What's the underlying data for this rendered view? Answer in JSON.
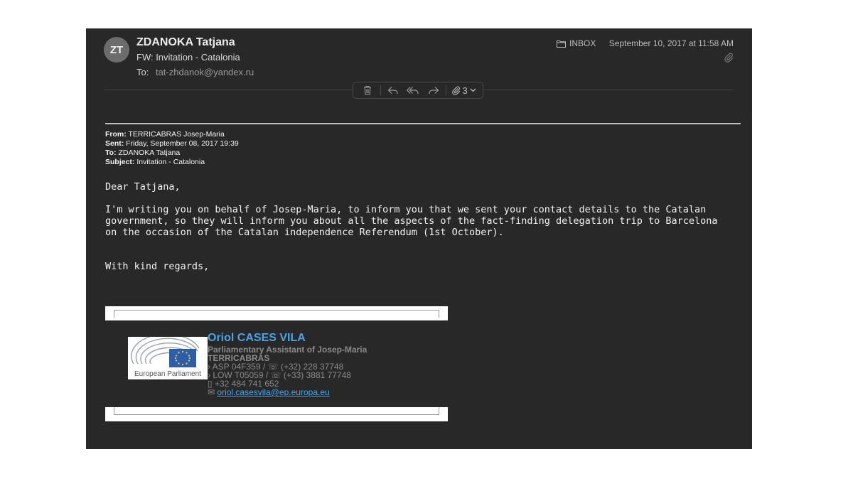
{
  "header": {
    "avatar_initials": "ZT",
    "sender": "ZDANOKA Tatjana",
    "subject": "FW: Invitation - Catalonia",
    "to_label": "To:",
    "to_address": "tat-zhdanok@yandex.ru",
    "mailbox": "INBOX",
    "date": "September 10, 2017 at 11:58 AM"
  },
  "toolbar": {
    "attachments_count": "3"
  },
  "forwarded": {
    "from_label": "From:",
    "from_value": "TERRICABRAS Josep-Maria",
    "sent_label": "Sent:",
    "sent_value": "Friday, September 08, 2017 19:39",
    "to_label": "To:",
    "to_value": "ZDANOKA Tatjana",
    "subject_label": "Subject:",
    "subject_value": "Invitation - Catalonia"
  },
  "message": {
    "greeting": "Dear Tatjana,",
    "body": "I'm writing you on behalf of Josep-Maria, to inform you that we sent your contact details to the Catalan government, so they will inform you about all the aspects of the fact-finding delegation trip to Barcelona on the occasion of the Catalan independence Referendum (1st October).",
    "closing": "With kind regards,"
  },
  "signature": {
    "logo_text": "European Parliament",
    "name": "Oriol CASES VILA",
    "role_line1": "Parliamentary Assistant of Josep-Maria",
    "role_line2": "TERRICABRAS",
    "line_asp": "ASP 04F359 / ☏ (+32) 228 37748",
    "line_low": "LOW T05059 / ☏ (+33) 3881 77748",
    "line_mobile": "+32 484 741 652",
    "email": "oriol.casesvila@ep.europa.eu"
  },
  "colors": {
    "window_bg": "#282828",
    "link": "#4aa3e8"
  }
}
